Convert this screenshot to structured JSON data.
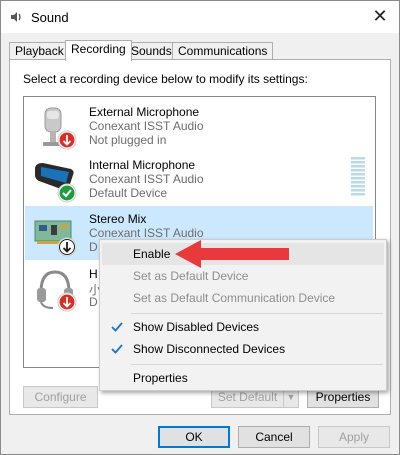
{
  "window": {
    "title": "Sound",
    "close_glyph": "✕"
  },
  "tabs": [
    {
      "label": "Playback",
      "active": false
    },
    {
      "label": "Recording",
      "active": true
    },
    {
      "label": "Sounds",
      "active": false
    },
    {
      "label": "Communications",
      "active": false
    }
  ],
  "instruction": "Select a recording device below to modify its settings:",
  "devices": [
    {
      "name": "External Microphone",
      "driver": "Conexant ISST Audio",
      "status": "Not plugged in",
      "icon": "external-microphone-icon",
      "badge": "red-down-arrow"
    },
    {
      "name": "Internal Microphone",
      "driver": "Conexant ISST Audio",
      "status": "Default Device",
      "icon": "internal-microphone-icon",
      "badge": "green-check"
    },
    {
      "name": "Stereo Mix",
      "driver": "Conexant ISST Audio",
      "status": "D",
      "icon": "sound-card-icon",
      "badge": "black-down-arrow",
      "selected": true
    },
    {
      "name": "H",
      "driver": "小",
      "status": "D",
      "icon": "headset-icon",
      "badge": "red-down-arrow"
    }
  ],
  "buttons": {
    "configure": "Configure",
    "set_default": "Set Default",
    "properties": "Properties",
    "ok": "OK",
    "cancel": "Cancel",
    "apply": "Apply"
  },
  "context_menu": {
    "items": [
      {
        "label": "Enable",
        "enabled": true,
        "checked": false
      },
      {
        "label": "Set as Default Device",
        "enabled": false,
        "checked": false
      },
      {
        "label": "Set as Default Communication Device",
        "enabled": false,
        "checked": false
      },
      {
        "label": "Show Disabled Devices",
        "enabled": true,
        "checked": true
      },
      {
        "label": "Show Disconnected Devices",
        "enabled": true,
        "checked": true
      },
      {
        "label": "Properties",
        "enabled": true,
        "checked": false
      }
    ]
  },
  "colors": {
    "accent": "#0078d7",
    "selected_row": "#cce8ff",
    "annotation_arrow": "#e8393c",
    "status_red": "#d93025",
    "status_green": "#1e9e3a"
  }
}
